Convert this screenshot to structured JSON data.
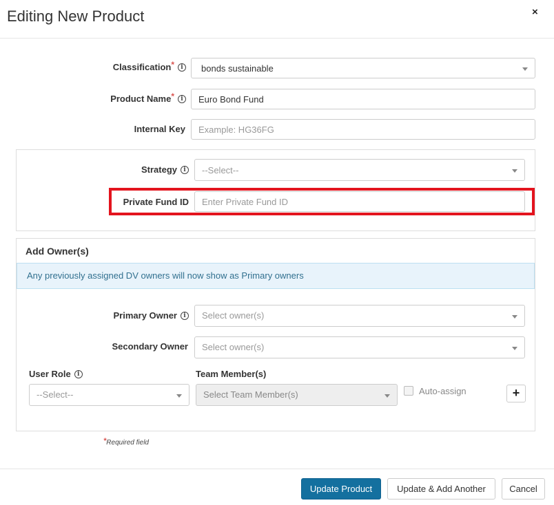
{
  "modal": {
    "title": "Editing New Product",
    "close_symbol": "×"
  },
  "form": {
    "classification": {
      "label": "Classification",
      "required_mark": "*",
      "value": "bonds sustainable"
    },
    "product_name": {
      "label": "Product Name",
      "required_mark": "*",
      "value": "Euro Bond Fund"
    },
    "internal_key": {
      "label": "Internal Key",
      "placeholder": "Example: HG36FG"
    }
  },
  "strategy_panel": {
    "strategy": {
      "label": "Strategy",
      "value": "--Select--"
    },
    "private_fund_id": {
      "label": "Private Fund ID",
      "placeholder": "Enter Private Fund ID"
    }
  },
  "owners": {
    "heading": "Add Owner(s)",
    "notice": "Any previously assigned DV owners will now show as Primary owners",
    "primary_owner": {
      "label": "Primary Owner",
      "placeholder": "Select owner(s)"
    },
    "secondary_owner": {
      "label": "Secondary Owner",
      "placeholder": "Select owner(s)"
    },
    "user_role": {
      "label": "User Role",
      "value": "--Select--"
    },
    "team_members": {
      "label": "Team Member(s)",
      "placeholder": "Select Team Member(s)"
    },
    "auto_assign_label": "Auto-assign",
    "add_symbol": "+"
  },
  "required_note": {
    "mark": "*",
    "text": "Required field"
  },
  "footer": {
    "update_label": "Update Product",
    "update_add_label": "Update & Add Another",
    "cancel_label": "Cancel"
  },
  "icons": {
    "info_icon": "i",
    "caret": "chevron-down-icon"
  },
  "colors": {
    "primary_button": "#14709f",
    "highlight": "#e3141e",
    "info_background": "#e8f3fb",
    "info_text": "#31708f",
    "required": "#d9534f"
  }
}
